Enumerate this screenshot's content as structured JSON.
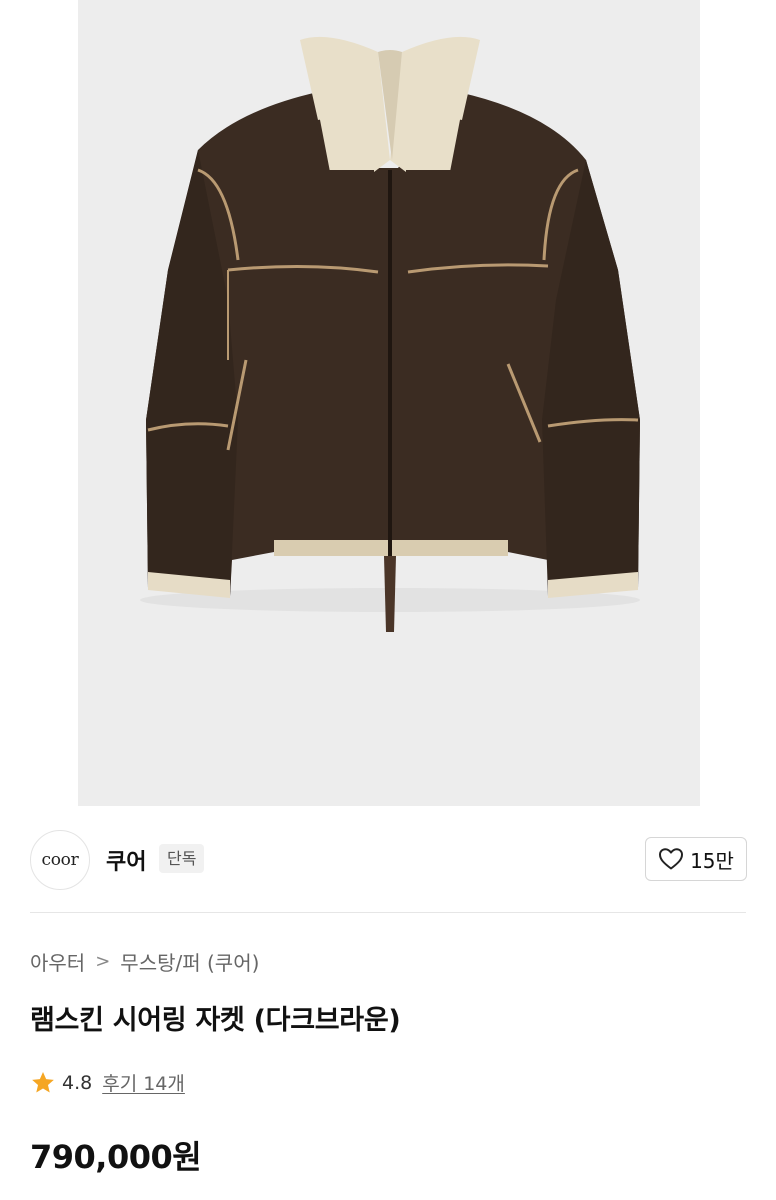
{
  "product": {
    "image_alt": "brown shearling leather jacket",
    "image_bg": "#ededed"
  },
  "brand": {
    "logo_text": "coor",
    "name": "쿠어",
    "badge": "단독"
  },
  "like": {
    "icon": "heart-outline-icon",
    "count": "15만"
  },
  "breadcrumb": {
    "items": [
      "아우터",
      "무스탕/퍼 (쿠어)"
    ],
    "separator": ">"
  },
  "title": "램스킨 시어링 자켓 (다크브라운)",
  "rating": {
    "icon": "star-icon",
    "icon_color": "#f5a623",
    "value": "4.8",
    "reviews_label": "후기 14개"
  },
  "price": "790,000원"
}
